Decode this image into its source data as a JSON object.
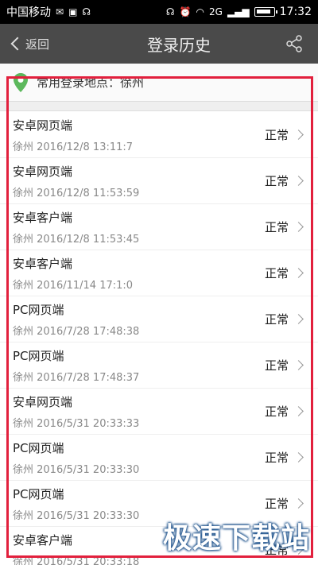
{
  "status_bar": {
    "carrier": "中国移动",
    "time": "17:32",
    "network": "2G"
  },
  "app_bar": {
    "back_label": "返回",
    "title": "登录历史"
  },
  "location": {
    "text": "常用登录地点：徐州"
  },
  "records": [
    {
      "device": "安卓网页端",
      "meta": "徐州 2016/12/8 13:11:7",
      "status": "正常"
    },
    {
      "device": "安卓网页端",
      "meta": "徐州 2016/12/8 11:53:59",
      "status": "正常"
    },
    {
      "device": "安卓客户端",
      "meta": "徐州 2016/12/8 11:53:45",
      "status": "正常"
    },
    {
      "device": "安卓客户端",
      "meta": "徐州 2016/11/14 17:1:0",
      "status": "正常"
    },
    {
      "device": "PC网页端",
      "meta": "徐州 2016/7/28 17:48:38",
      "status": "正常"
    },
    {
      "device": "PC网页端",
      "meta": "徐州 2016/7/28 17:48:37",
      "status": "正常"
    },
    {
      "device": "安卓网页端",
      "meta": "徐州 2016/5/31 20:33:33",
      "status": "正常"
    },
    {
      "device": "PC网页端",
      "meta": "徐州 2016/5/31 20:33:30",
      "status": "正常"
    },
    {
      "device": "PC网页端",
      "meta": "徐州 2016/5/31 20:33:30",
      "status": "正常"
    },
    {
      "device": "安卓客户端",
      "meta": "徐州 2016/5/31 20:33:18",
      "status": "正常"
    }
  ],
  "watermark": "极速下载站",
  "colors": {
    "app_bar": "#4a4a4a",
    "highlight_frame": "#e2203d",
    "location_pin": "#5cb85c"
  }
}
